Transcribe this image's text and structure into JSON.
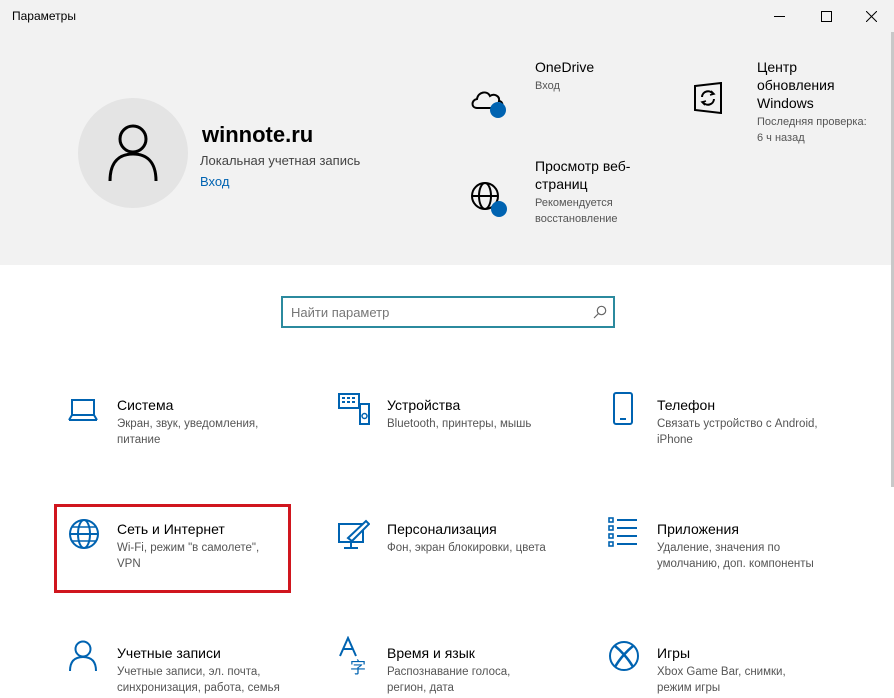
{
  "window": {
    "title": "Параметры",
    "controls": [
      "minimize-icon",
      "maximize-icon",
      "close-icon"
    ]
  },
  "account": {
    "name": "winnote.ru",
    "type": "Локальная учетная запись",
    "signin_link": "Вход",
    "avatar_icon": "person-icon"
  },
  "quick": [
    {
      "title_lines": [
        "OneDrive"
      ],
      "desc_lines": [
        "Вход"
      ],
      "icon": "cloud-icon"
    },
    {
      "title_lines": [
        "Просмотр веб-",
        "страниц"
      ],
      "desc_lines": [
        "Рекомендуется",
        "восстановление"
      ],
      "icon": "globe-icon"
    },
    {
      "title_lines": [
        "Центр",
        "обновления",
        "Windows"
      ],
      "desc_lines": [
        "Последняя проверка:",
        "6 ч назад"
      ],
      "icon": "sync-icon"
    }
  ],
  "search": {
    "placeholder": "Найти параметр",
    "value": ""
  },
  "categories": [
    {
      "title": "Система",
      "desc_lines": [
        "Экран, звук, уведомления,",
        "питание"
      ],
      "icon": "laptop-icon"
    },
    {
      "title": "Устройства",
      "desc_lines": [
        "Bluetooth, принтеры, мышь"
      ],
      "icon": "keyboard-icon"
    },
    {
      "title": "Телефон",
      "desc_lines": [
        "Связать устройство с Android,",
        "iPhone"
      ],
      "icon": "phone-icon"
    },
    {
      "title": "Сеть и Интернет",
      "desc_lines": [
        "Wi-Fi, режим \"в самолете\",",
        "VPN"
      ],
      "icon": "globe-icon"
    },
    {
      "title": "Персонализация",
      "desc_lines": [
        "Фон, экран блокировки, цвета"
      ],
      "icon": "paint-icon"
    },
    {
      "title": "Приложения",
      "desc_lines": [
        "Удаление, значения по",
        "умолчанию, доп. компоненты"
      ],
      "icon": "list-icon"
    },
    {
      "title": "Учетные записи",
      "desc_lines": [
        "Учетные записи, эл. почта,",
        "синхронизация, работа, семья"
      ],
      "icon": "user-icon"
    },
    {
      "title": "Время и язык",
      "desc_lines": [
        "Распознавание голоса,",
        "регион, дата"
      ],
      "icon": "language-icon"
    },
    {
      "title": "Игры",
      "desc_lines": [
        "Xbox Game Bar, снимки,",
        "режим игры"
      ],
      "icon": "xbox-icon"
    }
  ],
  "colors": {
    "accent": "#0063b1",
    "header_bg": "#f2f2f2",
    "highlight_border": "#d0161e",
    "search_border": "#2b8a9e"
  }
}
